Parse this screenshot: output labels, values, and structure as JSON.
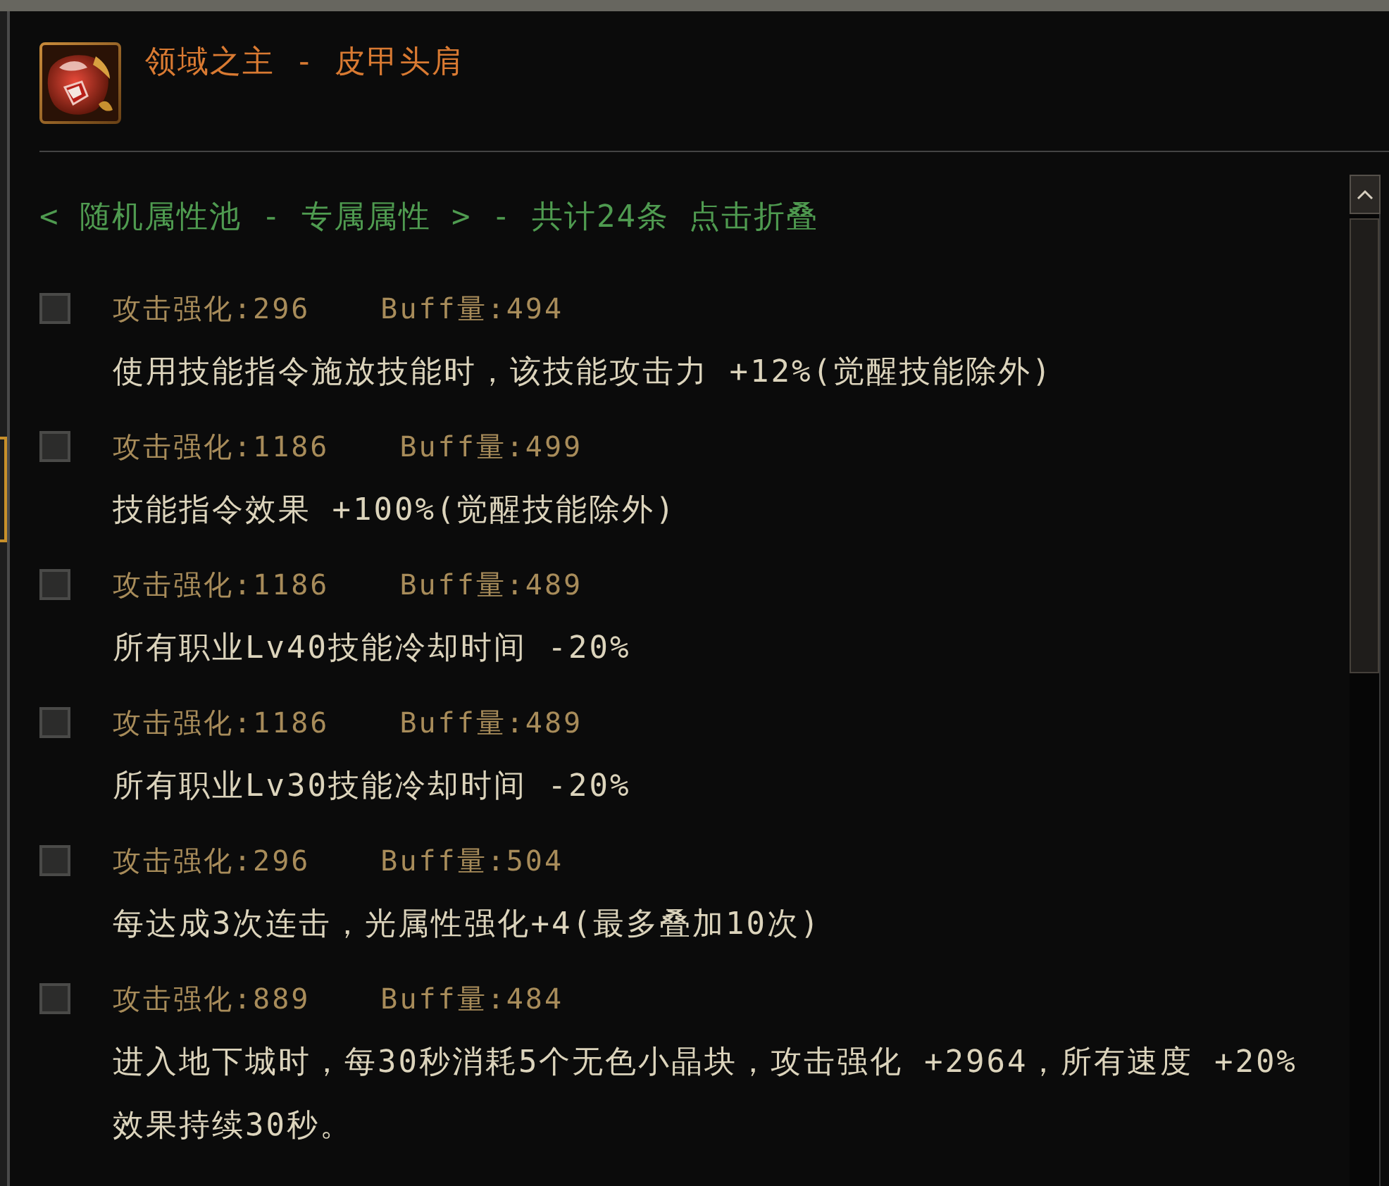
{
  "item": {
    "title": "领域之主 - 皮甲头肩"
  },
  "pool_header": "< 随机属性池 - 专属属性 > - 共计24条 点击折叠",
  "options": [
    {
      "checked": false,
      "attack": "攻击强化:296",
      "buff": "Buff量:494",
      "description": "使用技能指令施放技能时，该技能攻击力 +12%(觉醒技能除外)"
    },
    {
      "checked": false,
      "attack": "攻击强化:1186",
      "buff": "Buff量:499",
      "description": "技能指令效果 +100%(觉醒技能除外)"
    },
    {
      "checked": false,
      "attack": "攻击强化:1186",
      "buff": "Buff量:489",
      "description": "所有职业Lv40技能冷却时间 -20%"
    },
    {
      "checked": false,
      "attack": "攻击强化:1186",
      "buff": "Buff量:489",
      "description": "所有职业Lv30技能冷却时间 -20%"
    },
    {
      "checked": false,
      "attack": "攻击强化:296",
      "buff": "Buff量:504",
      "description": "每达成3次连击，光属性强化+4(最多叠加10次)"
    },
    {
      "checked": false,
      "attack": "攻击强化:889",
      "buff": "Buff量:484",
      "description": "进入地下城时，每30秒消耗5个无色小晶块，攻击强化 +2964，所有速度 +20%效果持续30秒。"
    }
  ]
}
